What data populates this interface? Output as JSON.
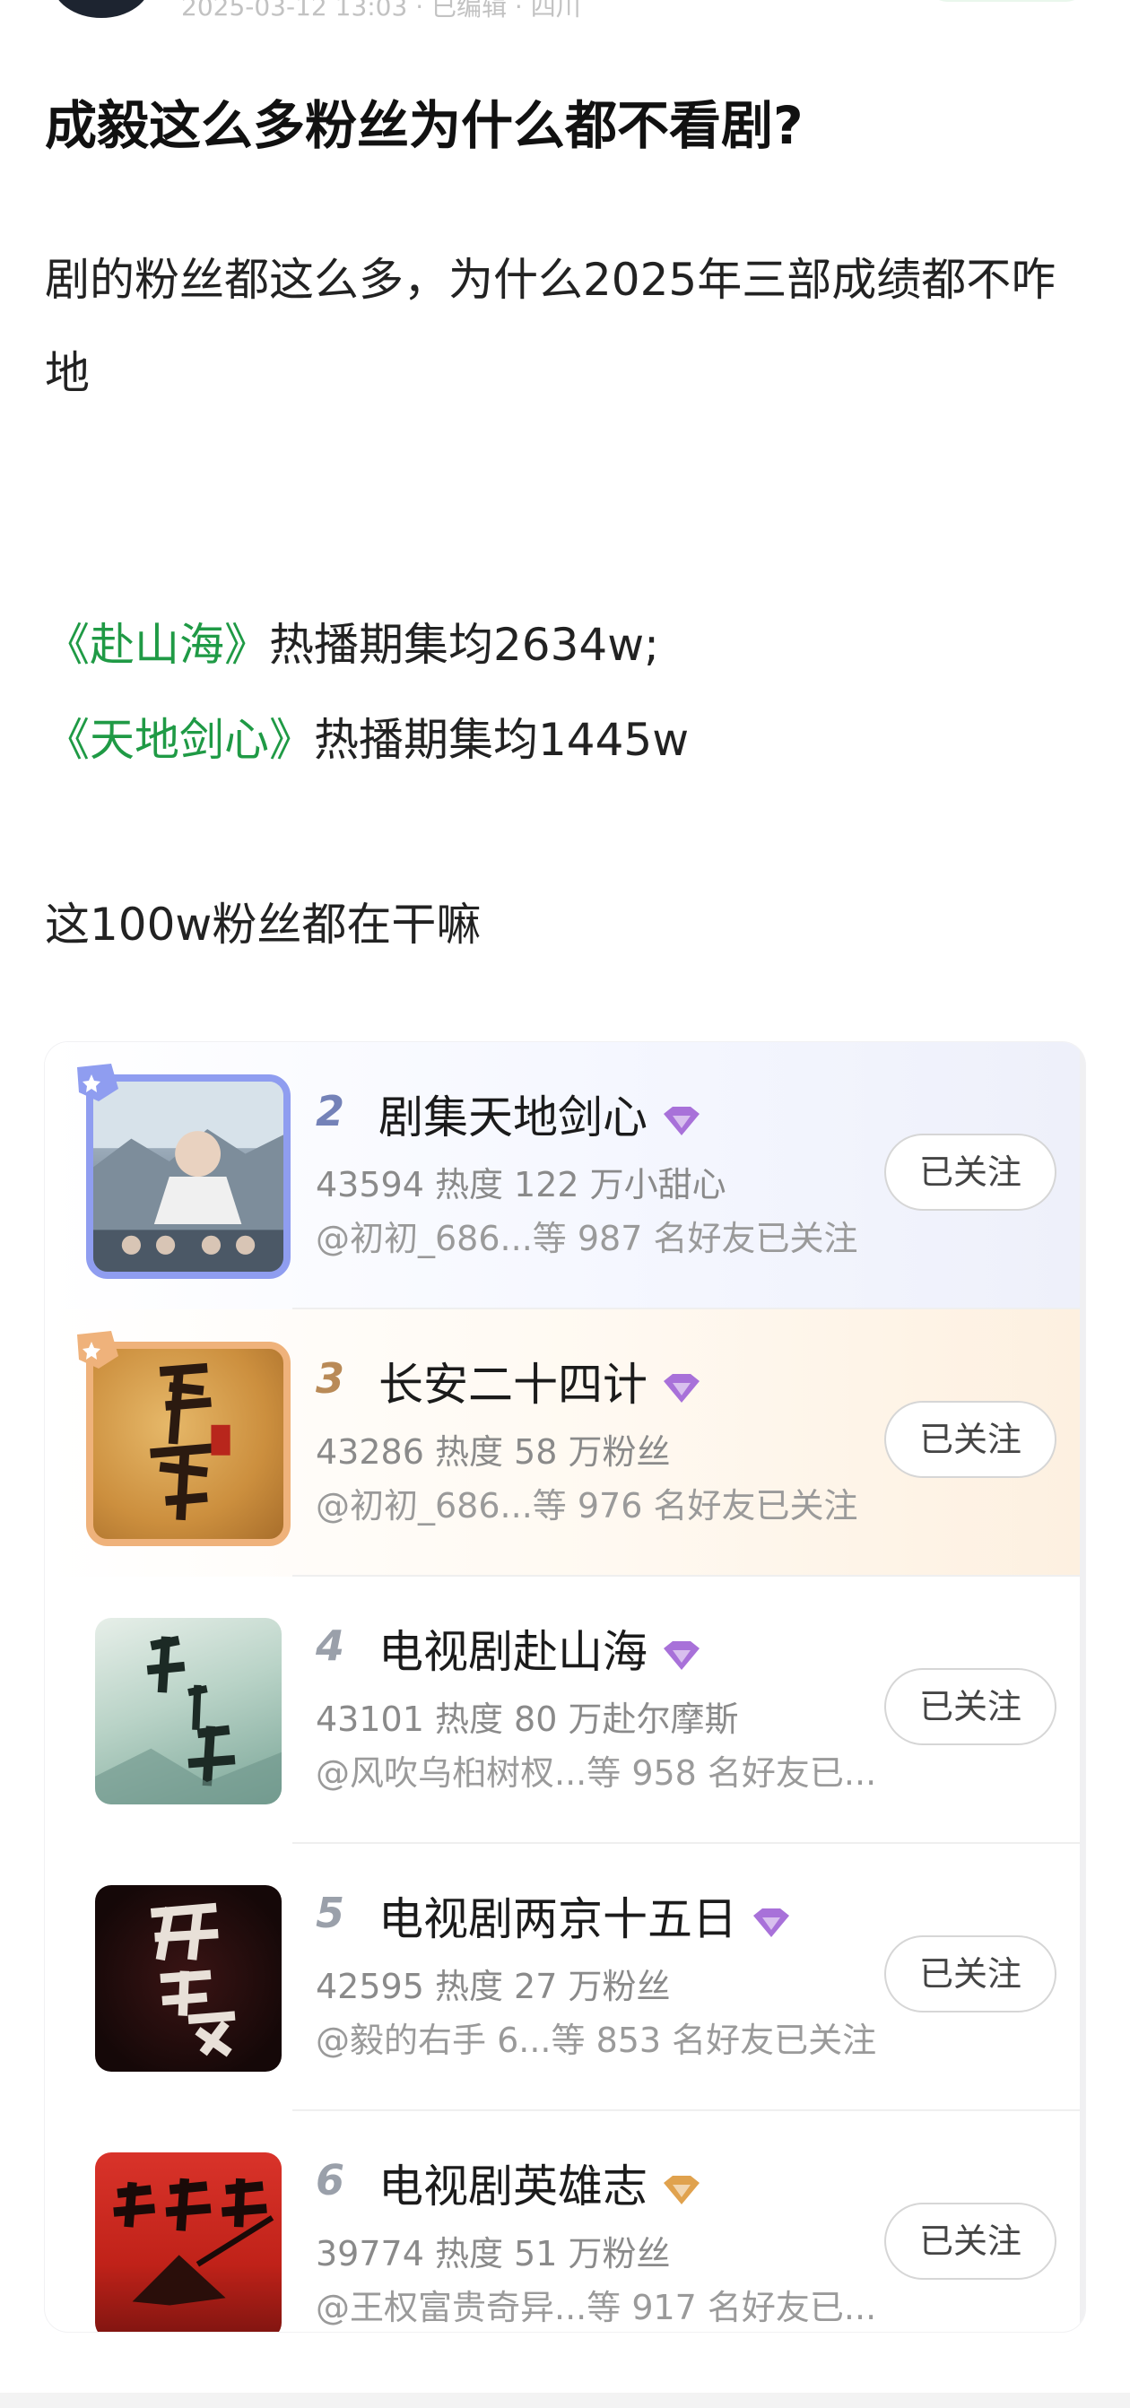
{
  "header": {
    "meta_text": "2025-03-12 13:03 · 已编辑 · 四川"
  },
  "post": {
    "title": "成毅这么多粉丝为什么都不看剧?",
    "intro": "剧的粉丝都这么多，为什么2025年三部成绩都不咋地",
    "line1_drama": "《赴山海》",
    "line1_rest": "热播期集均2634w;",
    "line2_drama": "《天地剑心》",
    "line2_rest": "热播期集均1445w",
    "line3": "这100w粉丝都在干嘛"
  },
  "ranking": {
    "items": [
      {
        "rank": "2",
        "name": "剧集天地剑心",
        "stats": "43594 热度 122 万小甜心",
        "friends": "@初初_686...等 987 名好友已关注",
        "button": "已关注",
        "poster_icon": "poster-tiandijianxin",
        "gem_color": "#a871d9"
      },
      {
        "rank": "3",
        "name": "长安二十四计",
        "stats": "43286 热度 58 万粉丝",
        "friends": "@初初_686...等 976 名好友已关注",
        "button": "已关注",
        "poster_icon": "poster-changan",
        "gem_color": "#a871d9"
      },
      {
        "rank": "4",
        "name": "电视剧赴山海",
        "stats": "43101 热度 80 万赴尔摩斯",
        "friends": "@风吹乌桕树杈...等 958 名好友已...",
        "button": "已关注",
        "poster_icon": "poster-fushanhai",
        "gem_color": "#a871d9"
      },
      {
        "rank": "5",
        "name": "电视剧两京十五日",
        "stats": "42595 热度 27 万粉丝",
        "friends": "@毅的右手 6...等 853 名好友已关注",
        "button": "已关注",
        "poster_icon": "poster-liangjing",
        "gem_color": "#a871d9"
      },
      {
        "rank": "6",
        "name": "电视剧英雄志",
        "stats": "39774 热度 51 万粉丝",
        "friends": "@王权富贵奇异...等 917 名好友已...",
        "button": "已关注",
        "poster_icon": "poster-yingxiongzhi",
        "gem_color": "#e0a24e"
      }
    ]
  }
}
